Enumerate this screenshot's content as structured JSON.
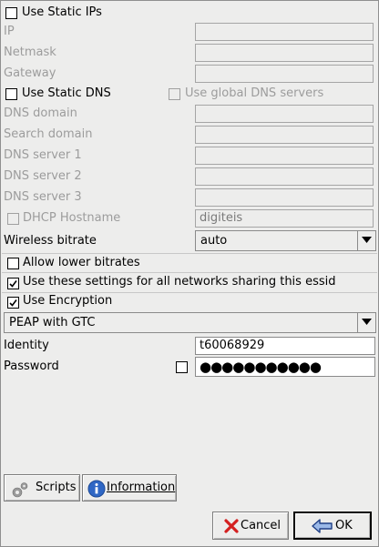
{
  "static_ip": {
    "checkbox_label": "Use Static IPs",
    "checked": false,
    "fields": [
      {
        "label": "IP",
        "value": ""
      },
      {
        "label": "Netmask",
        "value": ""
      },
      {
        "label": "Gateway",
        "value": ""
      }
    ]
  },
  "static_dns": {
    "checkbox_label": "Use Static DNS",
    "checked": false,
    "global_label": "Use global DNS servers",
    "global_checked": false,
    "fields": [
      {
        "label": "DNS domain",
        "value": ""
      },
      {
        "label": "Search domain",
        "value": ""
      },
      {
        "label": "DNS server 1",
        "value": ""
      },
      {
        "label": "DNS server 2",
        "value": ""
      },
      {
        "label": "DNS server 3",
        "value": ""
      }
    ]
  },
  "dhcp": {
    "checkbox_label": "DHCP Hostname",
    "checked": false,
    "value": "digiteis"
  },
  "bitrate": {
    "label": "Wireless bitrate",
    "value": "auto"
  },
  "options": {
    "allow_lower_label": "Allow lower bitrates",
    "allow_lower_checked": false,
    "global_settings_label": "Use these settings for all networks sharing this essid",
    "global_settings_checked": true,
    "encryption_label": "Use Encryption",
    "encryption_checked": true
  },
  "encryption": {
    "method": "PEAP with GTC",
    "identity_label": "Identity",
    "identity_value": "t60068929",
    "password_label": "Password",
    "password_show_checked": false,
    "password_dots": "●●●●●●●●●●●"
  },
  "buttons": {
    "scripts_label": "Scripts",
    "information_label": "Information",
    "cancel_label": "Cancel",
    "ok_label": "OK"
  },
  "colors": {
    "background": "#ededec",
    "disabled_text": "#9c9c9c",
    "info_blue": "#2f67c5",
    "cancel_red": "#d42020"
  }
}
